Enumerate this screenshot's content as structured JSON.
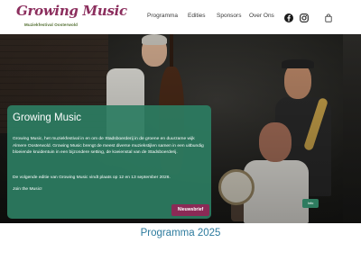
{
  "logo": {
    "title": "Growing Music",
    "subtitle": "Muziekfestival Oosterwold"
  },
  "nav": {
    "items": [
      {
        "label": "Programma"
      },
      {
        "label": "Edities"
      },
      {
        "label": "Sponsors"
      },
      {
        "label": "Over Ons"
      }
    ]
  },
  "icons": {
    "facebook": "facebook-icon",
    "instagram": "instagram-icon",
    "cart": "shopping-bag-icon"
  },
  "colors": {
    "brand": "#8c2f5e",
    "card_bg": "#2d7d62",
    "button": "#8b2a56",
    "section_title": "#2d7b9e"
  },
  "hero": {
    "small_button_label": "Info"
  },
  "card": {
    "title": "Growing Music",
    "paragraph1": "Growing Music, het muziekfestival in en om de Stadsboerderij in de groene en duurzame wijk Almere Oosterwold. Growing Music brengt de meest diverse muziekstijlen samen in een uitbundig bloeiende kruidentuin in een bijzondere setting, de koeienstal van de Stadsboerderij.",
    "paragraph2": "De volgende editie van Growing Music vindt plaats op 12 en 13 september 2026.",
    "paragraph3": "Join the Music!",
    "button_label": "Nieuwsbrief"
  },
  "section": {
    "title": "Programma 2025"
  }
}
